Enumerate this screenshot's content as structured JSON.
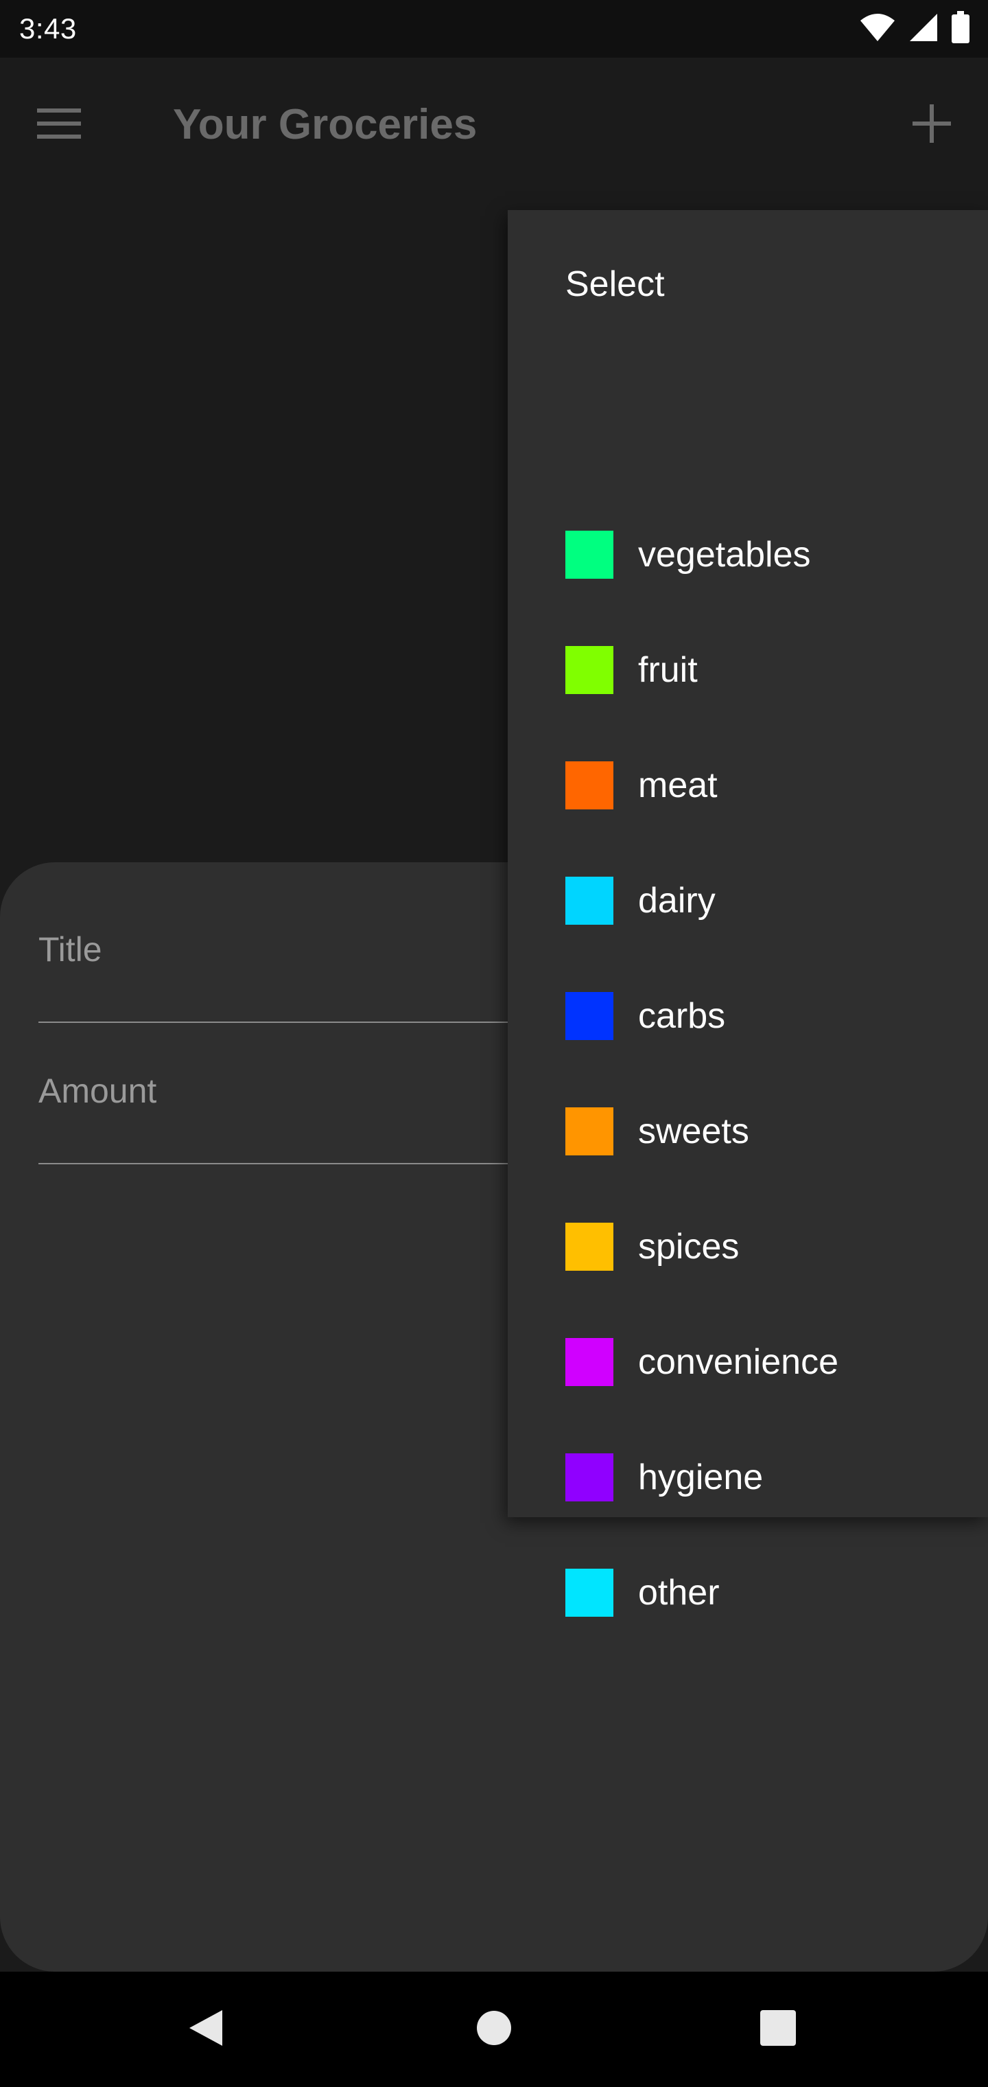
{
  "status_bar": {
    "time": "3:43",
    "icons": [
      "wifi-icon",
      "signal-icon",
      "battery-icon"
    ]
  },
  "app_bar": {
    "title": "Your Groceries",
    "menu_icon": "hamburger-menu-icon",
    "add_icon": "add-icon"
  },
  "form": {
    "title_placeholder": "Title",
    "amount_placeholder": "Amount"
  },
  "dropdown": {
    "header": "Select",
    "items": [
      {
        "label": "vegetables",
        "color": "#00ff80"
      },
      {
        "label": "fruit",
        "color": "#80ff00"
      },
      {
        "label": "meat",
        "color": "#ff6600"
      },
      {
        "label": "dairy",
        "color": "#00d5ff"
      },
      {
        "label": "carbs",
        "color": "#0033ff"
      },
      {
        "label": "sweets",
        "color": "#ff9500"
      },
      {
        "label": "spices",
        "color": "#ffbf00"
      },
      {
        "label": "convenience",
        "color": "#d000ff"
      },
      {
        "label": "hygiene",
        "color": "#9000ff"
      },
      {
        "label": "other",
        "color": "#00e5ff"
      }
    ]
  },
  "nav_bar": {
    "icons": [
      "back-icon",
      "home-icon",
      "recents-icon"
    ]
  }
}
